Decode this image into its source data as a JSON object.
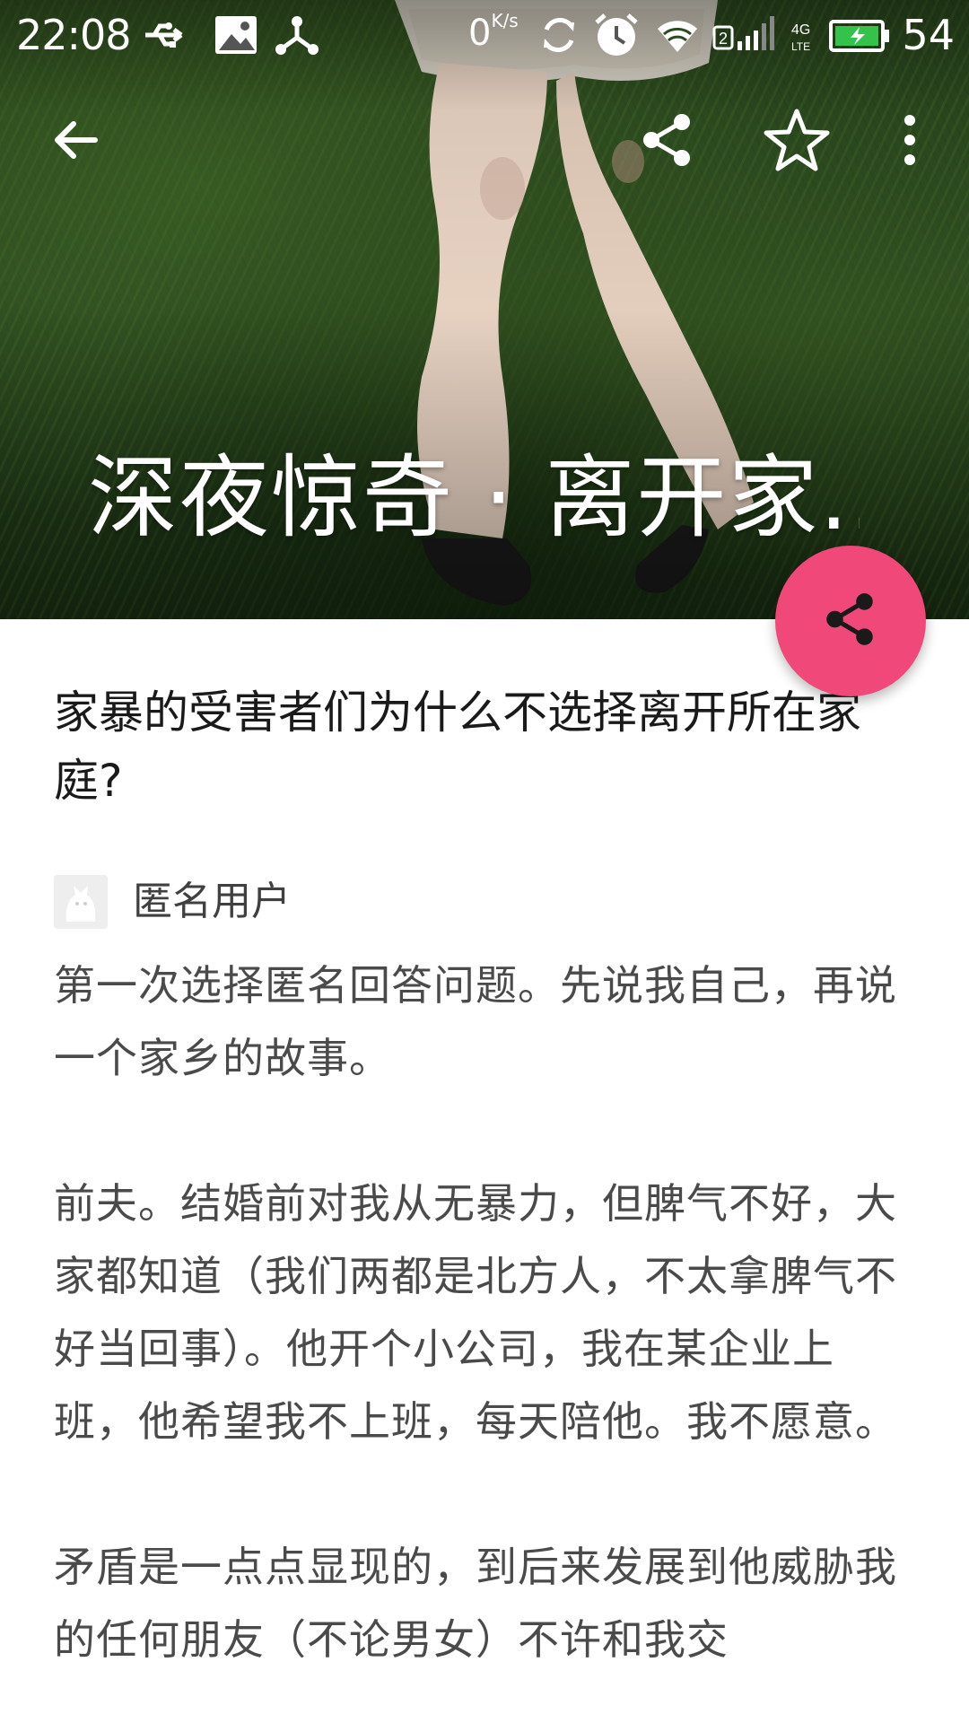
{
  "status_bar": {
    "time": "22:08",
    "net_speed": "0",
    "net_speed_unit": "K/s",
    "sim_slot": "2",
    "network_type": "4G LTE",
    "battery": "54",
    "icons": [
      "usb-icon",
      "image-icon",
      "share-hub-icon",
      "sync-icon",
      "alarm-icon",
      "wifi-icon",
      "signal-icon",
      "battery-icon"
    ]
  },
  "toolbar": {
    "back_icon": "arrow-left-icon",
    "share_icon": "share-icon",
    "favorite_icon": "star-outline-icon",
    "more_icon": "more-vertical-icon"
  },
  "header": {
    "title": "深夜惊奇 · 离开家.."
  },
  "fab": {
    "icon": "share-icon",
    "color": "#f1487a"
  },
  "question": {
    "title": "家暴的受害者们为什么不选择离开所在家庭?"
  },
  "author": {
    "name": "匿名用户"
  },
  "answer": {
    "paragraphs": [
      "第一次选择匿名回答问题。先说我自己，再说一个家乡的故事。",
      "前夫。结婚前对我从无暴力，但脾气不好，大家都知道（我们两都是北方人，不太拿脾气不好当回事）。他开个小公司，我在某企业上班，他希望我不上班，每天陪他。我不愿意。",
      "矛盾是一点点显现的，到后来发展到他威胁我的任何朋友（不论男女）不许和我交"
    ]
  }
}
